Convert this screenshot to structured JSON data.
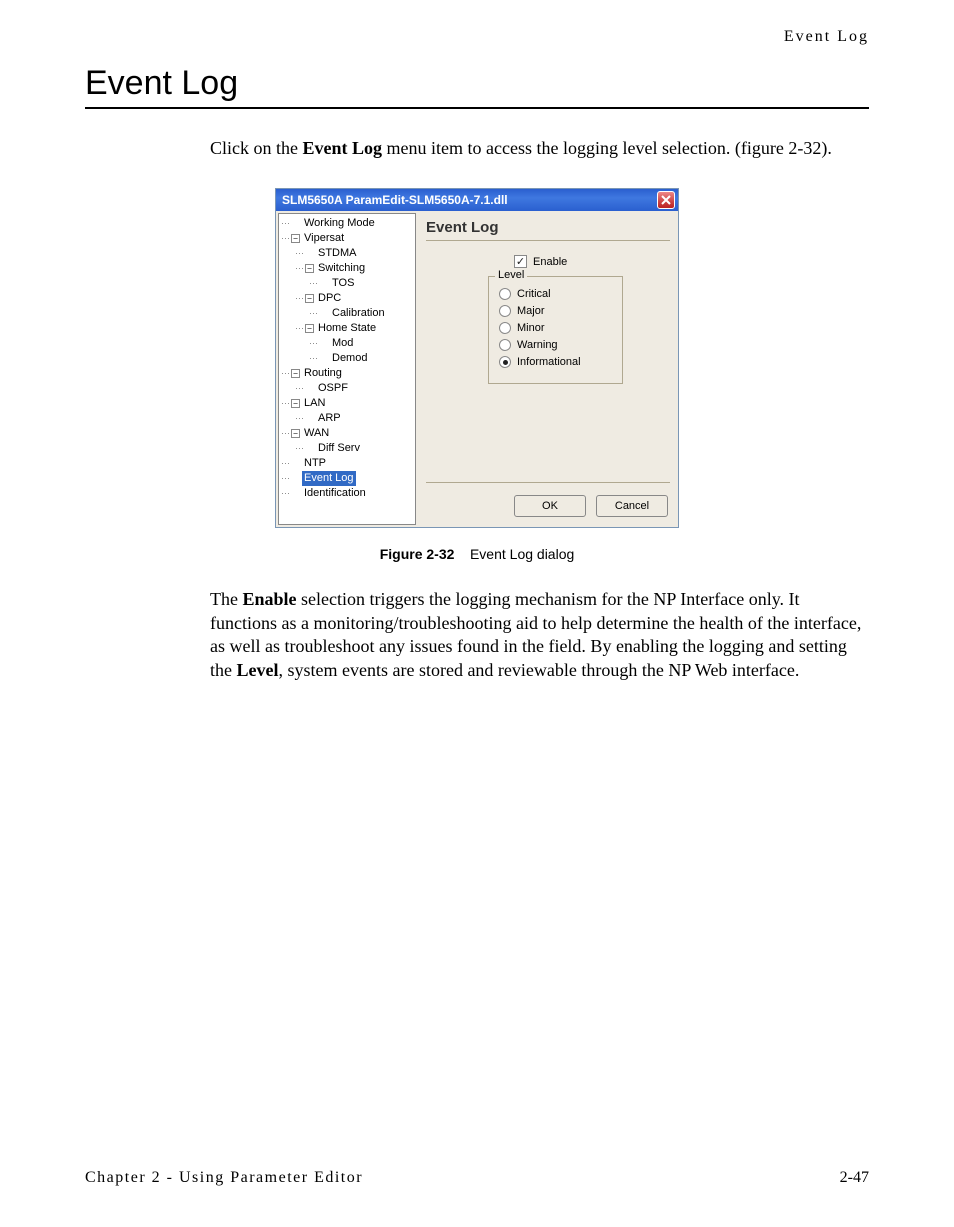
{
  "header": {
    "section": "Event Log"
  },
  "page": {
    "title": "Event Log"
  },
  "intro": {
    "pre": "Click on the ",
    "bold": "Event Log",
    "post": " menu item to access the logging level selection. (figure 2-32)."
  },
  "dialog": {
    "title": "SLM5650A ParamEdit-SLM5650A-7.1.dll",
    "close_name": "close",
    "panel_heading": "Event Log",
    "enable_label": "Enable",
    "enable_checked": true,
    "level_legend": "Level",
    "levels": [
      {
        "label": "Critical",
        "selected": false
      },
      {
        "label": "Major",
        "selected": false
      },
      {
        "label": "Minor",
        "selected": false
      },
      {
        "label": "Warning",
        "selected": false
      },
      {
        "label": "Informational",
        "selected": true
      }
    ],
    "ok_label": "OK",
    "cancel_label": "Cancel",
    "tree": [
      {
        "label": "Working Mode",
        "indent": 0,
        "exp": "",
        "sel": false
      },
      {
        "label": "Vipersat",
        "indent": 0,
        "exp": "-",
        "sel": false
      },
      {
        "label": "STDMA",
        "indent": 1,
        "exp": "",
        "sel": false
      },
      {
        "label": "Switching",
        "indent": 1,
        "exp": "-",
        "sel": false
      },
      {
        "label": "TOS",
        "indent": 2,
        "exp": "",
        "sel": false
      },
      {
        "label": "DPC",
        "indent": 1,
        "exp": "-",
        "sel": false
      },
      {
        "label": "Calibration",
        "indent": 2,
        "exp": "",
        "sel": false
      },
      {
        "label": "Home State",
        "indent": 1,
        "exp": "-",
        "sel": false
      },
      {
        "label": "Mod",
        "indent": 2,
        "exp": "",
        "sel": false
      },
      {
        "label": "Demod",
        "indent": 2,
        "exp": "",
        "sel": false
      },
      {
        "label": "Routing",
        "indent": 0,
        "exp": "-",
        "sel": false
      },
      {
        "label": "OSPF",
        "indent": 1,
        "exp": "",
        "sel": false
      },
      {
        "label": "LAN",
        "indent": 0,
        "exp": "-",
        "sel": false
      },
      {
        "label": "ARP",
        "indent": 1,
        "exp": "",
        "sel": false
      },
      {
        "label": "WAN",
        "indent": 0,
        "exp": "-",
        "sel": false
      },
      {
        "label": "Diff Serv",
        "indent": 1,
        "exp": "",
        "sel": false
      },
      {
        "label": "NTP",
        "indent": 0,
        "exp": "",
        "sel": false
      },
      {
        "label": "Event Log",
        "indent": 0,
        "exp": "",
        "sel": true
      },
      {
        "label": "Identification",
        "indent": 0,
        "exp": "",
        "sel": false
      }
    ]
  },
  "figure": {
    "number": "Figure 2-32",
    "caption": "Event Log dialog"
  },
  "paragraph": {
    "t0": "The ",
    "b0": "Enable",
    "t1": " selection triggers the logging mechanism for the NP Interface only. It functions as a monitoring/troubleshooting aid to help determine the health of the interface, as well as troubleshoot any issues found in the field. By enabling the logging and setting the ",
    "b1": "Level",
    "t2": ", system events are stored and reviewable through the NP Web interface."
  },
  "footer": {
    "left_chapter": "Chapter 2 - ",
    "left_title": "Using Parameter Editor",
    "right": "2-47"
  }
}
